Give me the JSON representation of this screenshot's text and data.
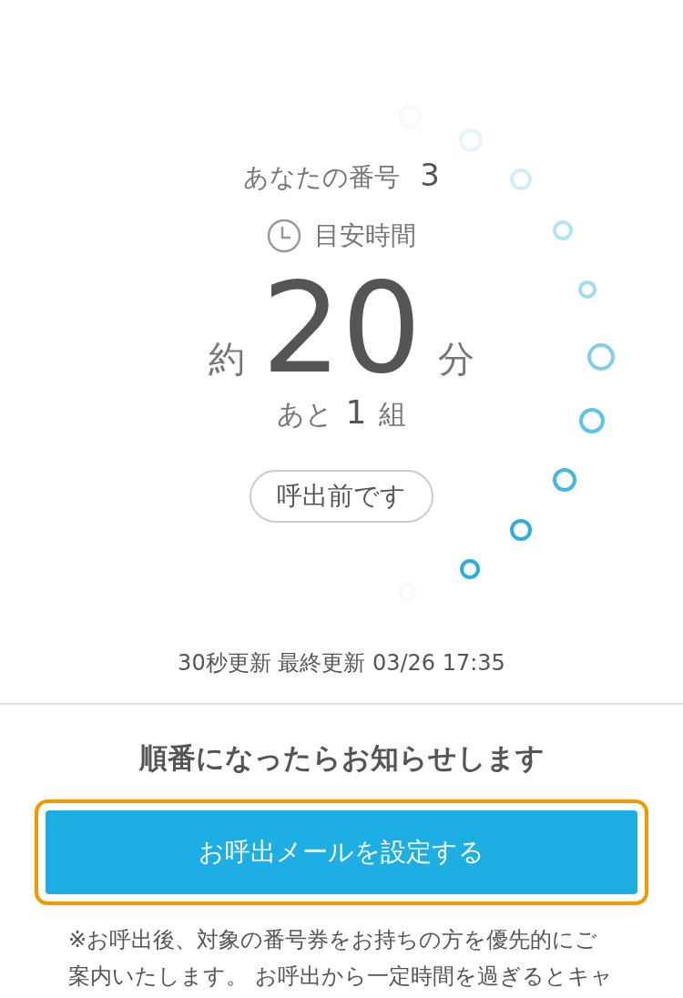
{
  "ticket": {
    "label": "あなたの番号",
    "number": "3"
  },
  "estimate": {
    "label": "目安時間",
    "prefix": "約",
    "value": "20",
    "unit": "分"
  },
  "remaining": {
    "prefix": "あと",
    "count": "1",
    "unit": "組"
  },
  "status": "呼出前です",
  "update": "30秒更新 最終更新 03/26 17:35",
  "notify": {
    "heading": "順番になったらお知らせします",
    "button": {
      "label": "お呼出メールを設定する",
      "focused": true
    },
    "note_lines": [
      "※お呼出後、対象の番号券をお持ちの方を優先的にご",
      "案内いたします。 お呼出から一定時間を過ぎるとキャ"
    ]
  }
}
